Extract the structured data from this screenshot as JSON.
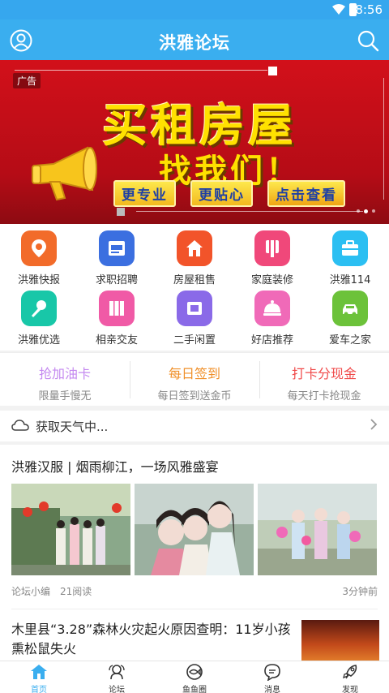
{
  "status": {
    "time": "8:56"
  },
  "appbar": {
    "title": "洪雅论坛"
  },
  "banner": {
    "ad_label": "广告",
    "headline": "买租房屋",
    "subline": "找我们！",
    "tags": [
      "更专业",
      "更贴心",
      "点击查看"
    ]
  },
  "grid": {
    "items": [
      {
        "label": "洪雅快报",
        "icon": "location-pin-icon",
        "color": "#f26b2a"
      },
      {
        "label": "求职招聘",
        "icon": "job-icon",
        "color": "#3b6fe0"
      },
      {
        "label": "房屋租售",
        "icon": "house-icon",
        "color": "#f2542a"
      },
      {
        "label": "家庭装修",
        "icon": "renovation-icon",
        "color": "#f0487a"
      },
      {
        "label": "洪雅114",
        "icon": "briefcase-icon",
        "color": "#2bbff2"
      },
      {
        "label": "洪雅优选",
        "icon": "microphone-icon",
        "color": "#18c7a8"
      },
      {
        "label": "相亲交友",
        "icon": "books-icon",
        "color": "#f05aa6"
      },
      {
        "label": "二手闲置",
        "icon": "shop-icon",
        "color": "#8a6ae8"
      },
      {
        "label": "好店推荐",
        "icon": "dish-cover-icon",
        "color": "#f06ab8"
      },
      {
        "label": "爱车之家",
        "icon": "car-icon",
        "color": "#6cc23a"
      }
    ]
  },
  "promo": [
    {
      "title": "抢加油卡",
      "subtitle": "限量手慢无",
      "color": "#c58af0"
    },
    {
      "title": "每日签到",
      "subtitle": "每日签到送金币",
      "color": "#f0902a"
    },
    {
      "title": "打卡分现金",
      "subtitle": "每天打卡抢现金",
      "color": "#f04a4a"
    }
  ],
  "weather": {
    "text": "获取天气中..."
  },
  "feed": {
    "post1": {
      "title": "洪雅汉服 | 烟雨柳江，一场风雅盛宴",
      "author": "论坛小编",
      "reads": "21阅读",
      "time_ago": "3分钟前"
    },
    "post2": {
      "title": "木里县“3.28”森林火灾起火原因查明：11岁小孩熏松鼠失火"
    }
  },
  "tabbar": {
    "tabs": [
      {
        "label": "首页",
        "icon": "home-icon",
        "active": true
      },
      {
        "label": "论坛",
        "icon": "forum-icon",
        "active": false
      },
      {
        "label": "鱼鱼圈",
        "icon": "fish-circle-icon",
        "active": false
      },
      {
        "label": "消息",
        "icon": "message-icon",
        "active": false
      },
      {
        "label": "发现",
        "icon": "rocket-icon",
        "active": false
      }
    ],
    "active_color": "#3aaeef"
  }
}
